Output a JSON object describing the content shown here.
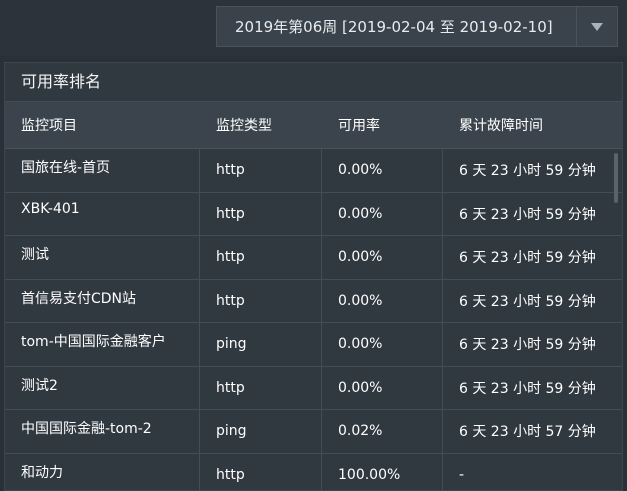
{
  "week_selector": {
    "value": "2019年第06周 [2019-02-04 至 2019-02-10]",
    "arrow_icon": "triangle-down-icon"
  },
  "panel": {
    "title": "可用率排名"
  },
  "table": {
    "headers": [
      "监控项目",
      "监控类型",
      "可用率",
      "累计故障时间"
    ],
    "rows": [
      {
        "name": "国旅在线-首页",
        "type": "http",
        "rate": "0.00%",
        "downtime": "6 天 23 小时 59 分钟"
      },
      {
        "name": "XBK-401",
        "type": "http",
        "rate": "0.00%",
        "downtime": "6 天 23 小时 59 分钟"
      },
      {
        "name": "测试",
        "type": "http",
        "rate": "0.00%",
        "downtime": "6 天 23 小时 59 分钟"
      },
      {
        "name": "首信易支付CDN站",
        "type": "http",
        "rate": "0.00%",
        "downtime": "6 天 23 小时 59 分钟"
      },
      {
        "name": "tom-中国国际金融客户",
        "type": "ping",
        "rate": "0.00%",
        "downtime": "6 天 23 小时 59 分钟"
      },
      {
        "name": "测试2",
        "type": "http",
        "rate": "0.00%",
        "downtime": "6 天 23 小时 59 分钟"
      },
      {
        "name": "中国国际金融-tom-2",
        "type": "ping",
        "rate": "0.02%",
        "downtime": "6 天 23 小时 57 分钟"
      },
      {
        "name": "和动力",
        "type": "http",
        "rate": "100.00%",
        "downtime": "-"
      }
    ]
  }
}
